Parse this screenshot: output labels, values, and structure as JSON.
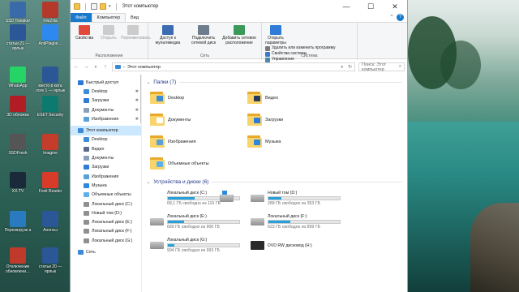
{
  "desktop": {
    "icons": [
      {
        "label": "SSD Tweaker",
        "color": "#3a6aa8"
      },
      {
        "label": "FileZilla",
        "color": "#b33a2a"
      },
      {
        "label": "статьи 21 — ярлык",
        "color": "#2b5797"
      },
      {
        "label": "AntiPlagiat…",
        "color": "#2d89ef"
      },
      {
        "label": "WhatsApp",
        "color": "#25d366"
      },
      {
        "label": "место в ката логе 1 — ярлык",
        "color": "#2b5797"
      },
      {
        "label": "3D обложка",
        "color": "#b01e23"
      },
      {
        "label": "ESET Security",
        "color": "#0d7a6f"
      },
      {
        "label": "SSDFresh",
        "color": "#555555"
      },
      {
        "label": "Imagine",
        "color": "#c43c2a"
      },
      {
        "label": "XX-TV",
        "color": "#1b2a3a"
      },
      {
        "label": "Foxit Reader",
        "color": "#d93b2b"
      },
      {
        "label": "Перезагрузк а",
        "color": "#2a7ac0"
      },
      {
        "label": "Анонсы",
        "color": "#2b5797"
      },
      {
        "label": "Отключение обновлени…",
        "color": "#c03a2b"
      },
      {
        "label": "статьи 20 — ярлык",
        "color": "#2b5797"
      }
    ]
  },
  "window": {
    "title": "Этот компьютер",
    "tabs": [
      "Файл",
      "Компьютер",
      "Вид"
    ],
    "ribbon": {
      "groups": [
        {
          "label": "Расположение",
          "buttons": [
            {
              "label": "Свойства",
              "enabled": true,
              "color": "#e04a3b"
            },
            {
              "label": "Открыть",
              "enabled": false,
              "color": "#cccccc"
            },
            {
              "label": "Переименовать",
              "enabled": false,
              "color": "#cccccc"
            }
          ]
        },
        {
          "label": "Сеть",
          "buttons": [
            {
              "label": "Доступ к мультимедиа",
              "enabled": true,
              "color": "#3c6bb0"
            },
            {
              "label": "Подключить сетевой диск",
              "enabled": true,
              "color": "#6d7d8d"
            },
            {
              "label": "Добавить сетевое расположение",
              "enabled": true,
              "color": "#3a9a5a"
            }
          ]
        },
        {
          "label": "Система",
          "buttons": [
            {
              "label": "Открыть параметры",
              "enabled": true,
              "color": "#2f7bd8"
            }
          ],
          "small": [
            {
              "label": "Удалить или изменить программу",
              "color": "#7a7a7a"
            },
            {
              "label": "Свойства системы",
              "color": "#3a7ac8"
            },
            {
              "label": "Управление",
              "color": "#4a8aa8"
            }
          ]
        }
      ]
    },
    "address": "Этот компьютер",
    "search_placeholder": "Поиск: Этот компьютер"
  },
  "nav": {
    "items": [
      {
        "label": "Быстрый доступ",
        "color": "#2b79d6",
        "pinned": false,
        "indent": 0,
        "selected": false
      },
      {
        "label": "Desktop",
        "color": "#3c8bd6",
        "pinned": true,
        "indent": 1,
        "selected": false
      },
      {
        "label": "Загрузки",
        "color": "#2f7bd8",
        "pinned": true,
        "indent": 1,
        "selected": false
      },
      {
        "label": "Документы",
        "color": "#8aa0b8",
        "pinned": true,
        "indent": 1,
        "selected": false
      },
      {
        "label": "Изображения",
        "color": "#5aa0d8",
        "pinned": true,
        "indent": 1,
        "selected": false
      },
      {
        "label": "Этот компьютер",
        "color": "#3c8bd6",
        "pinned": false,
        "indent": 0,
        "selected": true
      },
      {
        "label": "Desktop",
        "color": "#3c8bd6",
        "pinned": false,
        "indent": 1,
        "selected": false
      },
      {
        "label": "Видео",
        "color": "#5a6a8a",
        "pinned": false,
        "indent": 1,
        "selected": false
      },
      {
        "label": "Документы",
        "color": "#8aa0b8",
        "pinned": false,
        "indent": 1,
        "selected": false
      },
      {
        "label": "Загрузки",
        "color": "#2f7bd8",
        "pinned": false,
        "indent": 1,
        "selected": false
      },
      {
        "label": "Изображения",
        "color": "#5aa0d8",
        "pinned": false,
        "indent": 1,
        "selected": false
      },
      {
        "label": "Музыка",
        "color": "#2e86de",
        "pinned": false,
        "indent": 1,
        "selected": false
      },
      {
        "label": "Объемные объекты",
        "color": "#5fb0e8",
        "pinned": false,
        "indent": 1,
        "selected": false
      },
      {
        "label": "Локальный диск (C:)",
        "color": "#8f8f8f",
        "pinned": false,
        "indent": 1,
        "selected": false
      },
      {
        "label": "Новый том (D:)",
        "color": "#8f8f8f",
        "pinned": false,
        "indent": 1,
        "selected": false
      },
      {
        "label": "Локальный диск (E:)",
        "color": "#8f8f8f",
        "pinned": false,
        "indent": 1,
        "selected": false
      },
      {
        "label": "Локальный диск (F:)",
        "color": "#8f8f8f",
        "pinned": false,
        "indent": 1,
        "selected": false
      },
      {
        "label": "Локальный диск (G:)",
        "color": "#8f8f8f",
        "pinned": false,
        "indent": 1,
        "selected": false
      },
      {
        "label": "Сеть",
        "color": "#3c8bd6",
        "pinned": false,
        "indent": 0,
        "selected": false
      }
    ]
  },
  "folders": {
    "header": "Папки (7)",
    "items": [
      {
        "label": "Desktop",
        "badge": "#3c8bd6"
      },
      {
        "label": "Видео",
        "badge": "#2a3a5a"
      },
      {
        "label": "Документы",
        "badge": "#ffffff"
      },
      {
        "label": "Загрузки",
        "badge": "#2f7bd8"
      },
      {
        "label": "Изображения",
        "badge": "#5aa0d8"
      },
      {
        "label": "Музыка",
        "badge": "#2e86de"
      },
      {
        "label": "Объемные объекты",
        "badge": "#5fb0e8"
      }
    ]
  },
  "drives": {
    "header": "Устройства и диски (6)",
    "items": [
      {
        "label": "Локальный диск (C:)",
        "free": "68,1 ГБ свободно из 110 ГБ",
        "used": 0.38,
        "type": "win"
      },
      {
        "label": "Новый том (D:)",
        "free": "289 ГБ свободно из 353 ГБ",
        "used": 0.18,
        "type": "hdd"
      },
      {
        "label": "Локальный диск (E:)",
        "free": "689 ГБ свободно из 900 ГБ",
        "used": 0.23,
        "type": "hdd"
      },
      {
        "label": "Локальный диск (F:)",
        "free": "623 ГБ свободно из 899 ГБ",
        "used": 0.31,
        "type": "hdd"
      },
      {
        "label": "Локальный диск (G:)",
        "free": "904 ГБ свободно из 993 ГБ",
        "used": 0.09,
        "type": "hdd"
      },
      {
        "label": "DVD RW дисковод (H:)",
        "free": "",
        "used": null,
        "type": "dvd"
      }
    ]
  }
}
